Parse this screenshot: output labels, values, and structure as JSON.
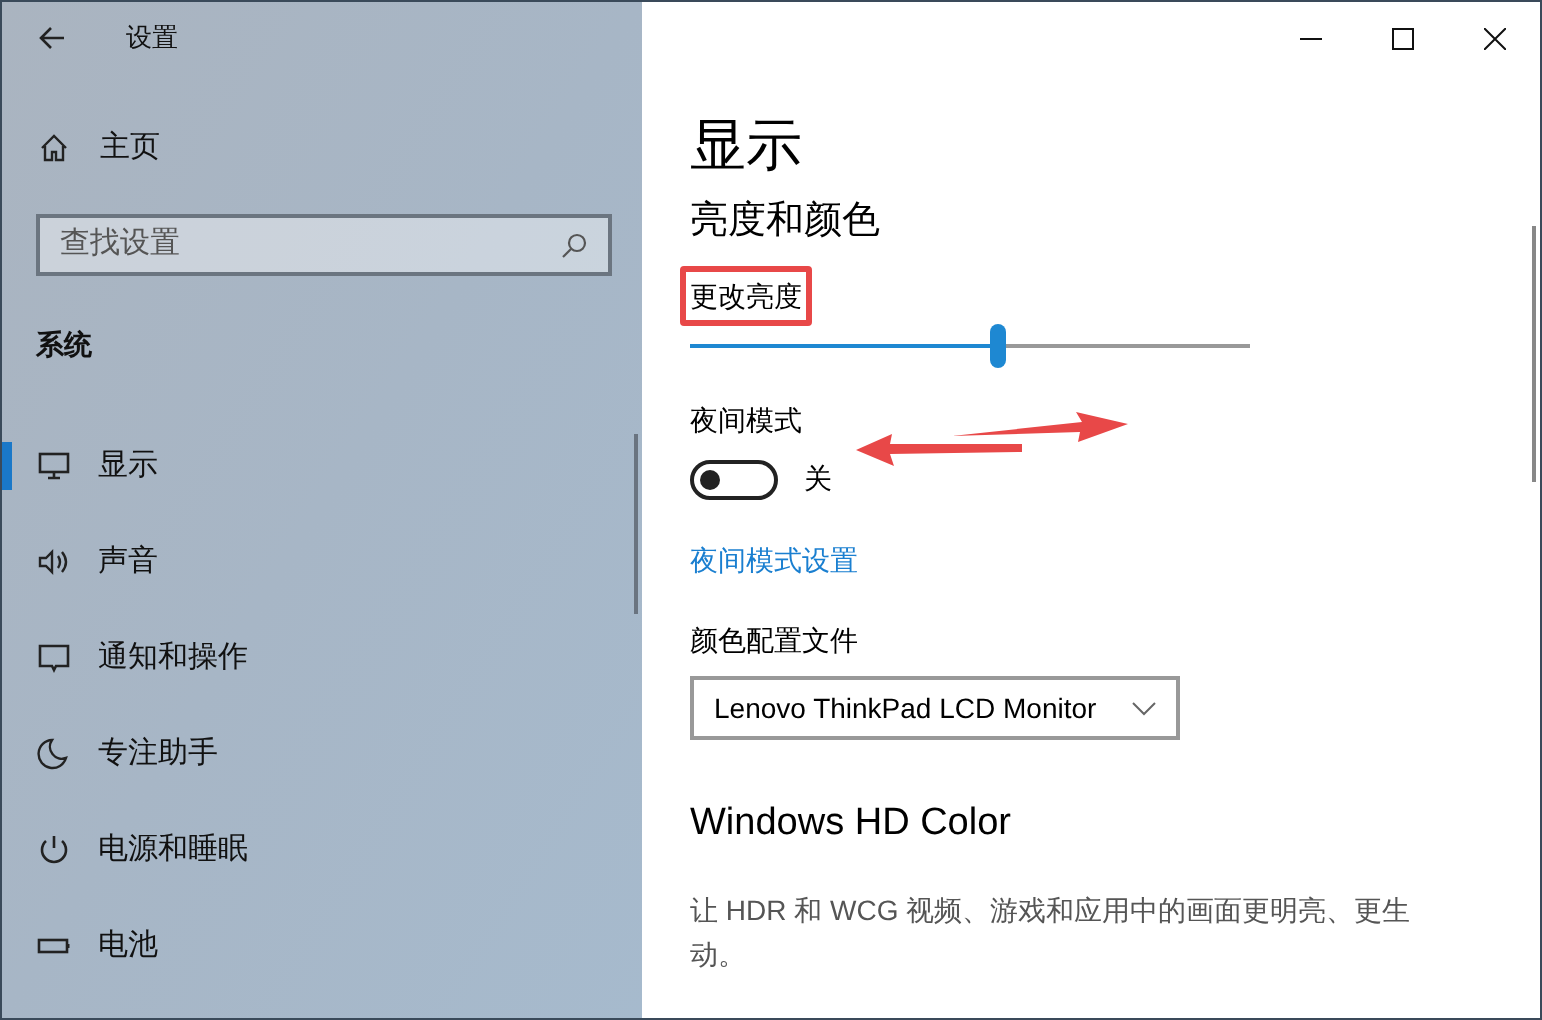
{
  "window": {
    "title": "设置"
  },
  "sidebar": {
    "home": "主页",
    "search": {
      "placeholder": "查找设置"
    },
    "section": "系统",
    "items": [
      {
        "label": "显示",
        "selected": true
      },
      {
        "label": "声音",
        "selected": false
      },
      {
        "label": "通知和操作",
        "selected": false
      },
      {
        "label": "专注助手",
        "selected": false
      },
      {
        "label": "电源和睡眠",
        "selected": false
      },
      {
        "label": "电池",
        "selected": false
      }
    ]
  },
  "page": {
    "title": "显示",
    "section": "亮度和颜色",
    "brightness": {
      "label": "更改亮度",
      "level": 0.55
    },
    "night_light": {
      "label": "夜间模式",
      "on": false,
      "state_text": "关"
    },
    "night_light_link": "夜间模式设置",
    "color_profile": {
      "label": "颜色配置文件",
      "value": "Lenovo ThinkPad LCD Monitor"
    },
    "hdr": {
      "title": "Windows HD Color",
      "description": "让 HDR 和 WCG 视频、游戏和应用中的画面更明亮、更生动。"
    }
  }
}
